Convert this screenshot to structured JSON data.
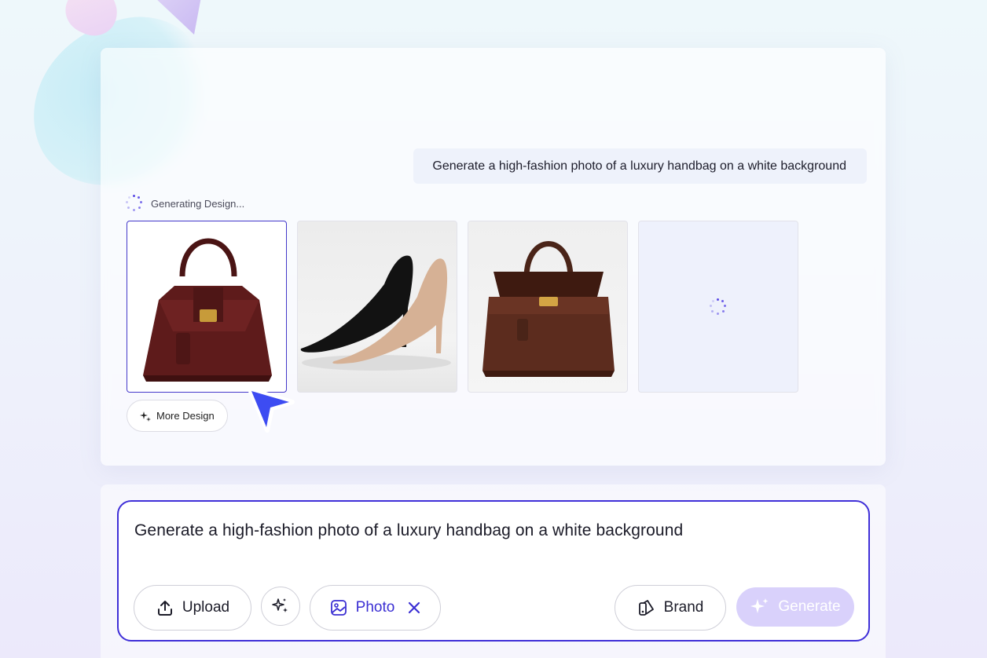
{
  "chat": {
    "prompt_bubble": "Generate a high-fashion photo of a luxury handbag on a white background",
    "status_text": "Generating Design...",
    "thumbnails": [
      {
        "subject": "burgundy-handbag",
        "selected": true
      },
      {
        "subject": "pumps-pair",
        "selected": false
      },
      {
        "subject": "brown-handbag",
        "selected": false
      },
      {
        "subject": "loading",
        "selected": false
      }
    ],
    "more_design_label": "More Design"
  },
  "composer": {
    "input_value": "Generate a high-fashion photo of a luxury handbag on a white background",
    "upload_label": "Upload",
    "photo_label": "Photo",
    "brand_label": "Brand",
    "generate_label": "Generate"
  },
  "colors": {
    "accent": "#3f2fd8",
    "accent_light": "#d9d1fb",
    "photo_chip_text": "#3b2fd3"
  }
}
